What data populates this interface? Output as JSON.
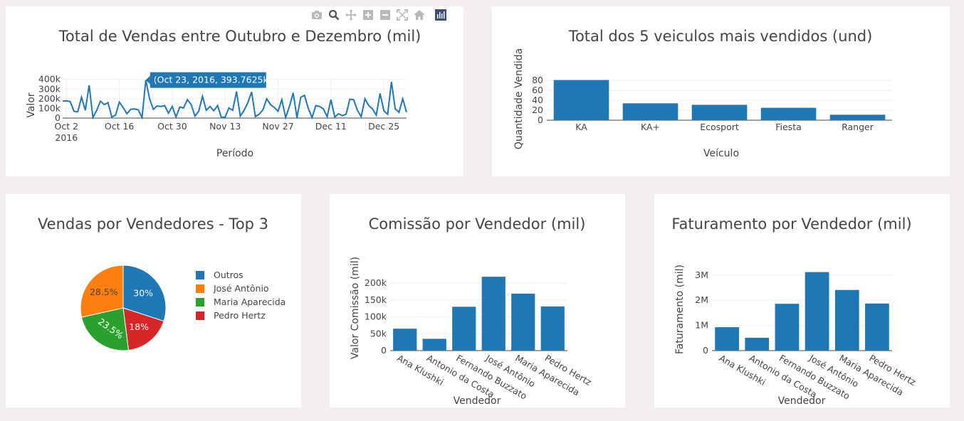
{
  "colors": {
    "primary": "#1f77b4",
    "orange": "#ff7f0e",
    "green": "#2ca02c",
    "red": "#d62728",
    "page_bg": "#f4eeee",
    "tooltip_bg": "#1f77b4"
  },
  "modebar": {
    "icons": [
      "camera-icon",
      "zoom-icon",
      "pan-icon",
      "zoom-in-icon",
      "zoom-out-icon",
      "autoscale-icon",
      "home-icon",
      "plotly-logo-icon"
    ]
  },
  "chart_data": [
    {
      "id": "sales",
      "type": "line",
      "title": "Total de Vendas entre Outubro e Dezembro (mil)",
      "xlabel": "Período",
      "ylabel": "Valor",
      "x_ticks": [
        "Oct 2",
        "Oct 16",
        "Oct 30",
        "Nov 13",
        "Nov 27",
        "Dec 11",
        "Dec 25"
      ],
      "x_tick_year": "2016",
      "x_range": [
        "2016-10-01",
        "2016-12-31"
      ],
      "y_ticks": [
        "0",
        "100k",
        "200k",
        "300k",
        "400k"
      ],
      "ylim": [
        0,
        420000
      ],
      "x": [
        "2016-10-01",
        "2016-10-02",
        "2016-10-03",
        "2016-10-04",
        "2016-10-05",
        "2016-10-06",
        "2016-10-07",
        "2016-10-08",
        "2016-10-09",
        "2016-10-10",
        "2016-10-11",
        "2016-10-12",
        "2016-10-13",
        "2016-10-14",
        "2016-10-15",
        "2016-10-16",
        "2016-10-17",
        "2016-10-18",
        "2016-10-19",
        "2016-10-20",
        "2016-10-21",
        "2016-10-22",
        "2016-10-23",
        "2016-10-24",
        "2016-10-25",
        "2016-10-26",
        "2016-10-27",
        "2016-10-28",
        "2016-10-29",
        "2016-10-30",
        "2016-10-31",
        "2016-11-01",
        "2016-11-02",
        "2016-11-03",
        "2016-11-04",
        "2016-11-05",
        "2016-11-06",
        "2016-11-07",
        "2016-11-08",
        "2016-11-09",
        "2016-11-10",
        "2016-11-11",
        "2016-11-12",
        "2016-11-13",
        "2016-11-14",
        "2016-11-15",
        "2016-11-16",
        "2016-11-17",
        "2016-11-18",
        "2016-11-19",
        "2016-11-20",
        "2016-11-21",
        "2016-11-22",
        "2016-11-23",
        "2016-11-24",
        "2016-11-25",
        "2016-11-26",
        "2016-11-27",
        "2016-11-28",
        "2016-11-29",
        "2016-11-30",
        "2016-12-01",
        "2016-12-02",
        "2016-12-03",
        "2016-12-04",
        "2016-12-05",
        "2016-12-06",
        "2016-12-07",
        "2016-12-08",
        "2016-12-09",
        "2016-12-10",
        "2016-12-11",
        "2016-12-12",
        "2016-12-13",
        "2016-12-14",
        "2016-12-15",
        "2016-12-16",
        "2016-12-17",
        "2016-12-18",
        "2016-12-19",
        "2016-12-20",
        "2016-12-21",
        "2016-12-22",
        "2016-12-23",
        "2016-12-24",
        "2016-12-25",
        "2016-12-26",
        "2016-12-27",
        "2016-12-28",
        "2016-12-29",
        "2016-12-30",
        "2016-12-31"
      ],
      "y": [
        175000,
        180000,
        170000,
        70000,
        65000,
        215000,
        80000,
        340000,
        5000,
        80000,
        175000,
        140000,
        160000,
        10000,
        30000,
        165000,
        110000,
        45000,
        90000,
        95000,
        85000,
        5000,
        393762,
        200000,
        90000,
        125000,
        120000,
        130000,
        50000,
        120000,
        10000,
        115000,
        105000,
        190000,
        140000,
        20000,
        70000,
        225000,
        80000,
        120000,
        75000,
        130000,
        5000,
        10000,
        105000,
        80000,
        275000,
        20000,
        80000,
        160000,
        270000,
        15000,
        40000,
        85000,
        200000,
        140000,
        110000,
        70000,
        190000,
        5000,
        120000,
        260000,
        5000,
        215000,
        235000,
        100000,
        5000,
        130000,
        120000,
        95000,
        15000,
        190000,
        10000,
        45000,
        25000,
        40000,
        195000,
        190000,
        80000,
        15000,
        200000,
        130000,
        95000,
        30000,
        255000,
        75000,
        40000,
        375000,
        95000,
        60000,
        200000,
        60000
      ],
      "tooltip": {
        "x": "2016-10-23",
        "y": 393762,
        "text": "(Oct 23, 2016, 393.7625k)"
      }
    },
    {
      "id": "vehicles",
      "type": "bar",
      "title": "Total dos 5 veiculos mais vendidos (und)",
      "xlabel": "Veículo",
      "ylabel": "Quantidade Vendida",
      "categories": [
        "KA",
        "KA+",
        "Ecosport",
        "Fiesta",
        "Ranger"
      ],
      "values": [
        81,
        34,
        31,
        25,
        11
      ],
      "y_ticks": [
        "0",
        "20",
        "40",
        "60",
        "80"
      ],
      "ylim": [
        0,
        86
      ]
    },
    {
      "id": "pie",
      "type": "pie",
      "title": "Vendas por Vendedores - Top 3",
      "labels": [
        "Outros",
        "José Antônio",
        "Maria Aparecida",
        "Pedro Hertz"
      ],
      "values": [
        30,
        28.5,
        23.5,
        18
      ],
      "slice_labels": [
        "30%",
        "28.5%",
        "23.5%",
        "18%"
      ],
      "legend_order": [
        "Outros",
        "José Antônio",
        "Maria Aparecida",
        "Pedro Hertz"
      ],
      "legend_colors": [
        "#1f77b4",
        "#ff7f0e",
        "#2ca02c",
        "#d62728"
      ],
      "slice_order": [
        0,
        3,
        2,
        1
      ],
      "slice_colors": [
        "#1f77b4",
        "#d62728",
        "#2ca02c",
        "#ff7f0e"
      ]
    },
    {
      "id": "commission",
      "type": "bar",
      "title": "Comissão por Vendedor (mil)",
      "xlabel": "Vendedor",
      "ylabel": "Valor Comissão (mil)",
      "categories": [
        "Ana Klushki",
        "Antonio da Costa",
        "Fernando Buzzato",
        "José Antônio",
        "Maria Aparecida",
        "Pedro Hertz"
      ],
      "values": [
        65000,
        35000,
        130000,
        219000,
        169000,
        131000
      ],
      "y_ticks": [
        "0",
        "50k",
        "100k",
        "150k",
        "200k"
      ],
      "ylim": [
        0,
        232000
      ]
    },
    {
      "id": "revenue",
      "type": "bar",
      "title": "Faturamento por Vendedor (mil)",
      "xlabel": "Vendedor",
      "ylabel": "Faturamento (mil)",
      "categories": [
        "Ana Klushki",
        "Antonio da Costa",
        "Fernando Buzzato",
        "José Antônio",
        "Maria Aparecida",
        "Pedro Hertz"
      ],
      "values": [
        930000,
        510000,
        1860000,
        3120000,
        2410000,
        1870000
      ],
      "y_ticks": [
        "0",
        "1M",
        "2M",
        "3M"
      ],
      "ylim": [
        0,
        3250000
      ]
    }
  ]
}
